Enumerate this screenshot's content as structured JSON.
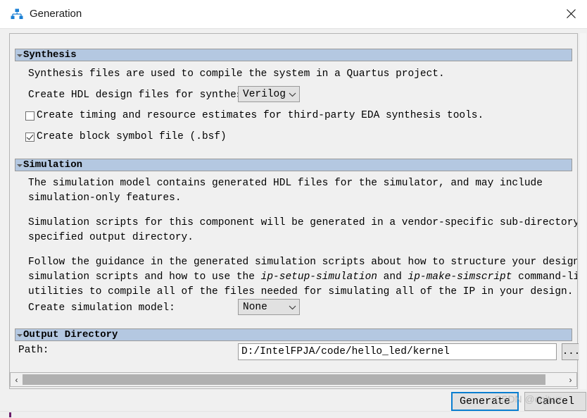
{
  "window": {
    "title": "Generation",
    "icon": "hierarchy-icon",
    "close_icon": "close-icon"
  },
  "sections": {
    "synthesis": {
      "title": "Synthesis",
      "collapse_icon": "chevron-down-icon",
      "paragraph": "Synthesis files are used to compile the system in a Quartus project.",
      "hdl_label": "Create HDL design files for synthesis:",
      "hdl_value": "Verilog",
      "checkboxes": [
        {
          "label": "Create timing and resource estimates for third-party EDA synthesis tools.",
          "checked": false
        },
        {
          "label": "Create block symbol file (.bsf)",
          "checked": true
        }
      ]
    },
    "simulation": {
      "title": "Simulation",
      "collapse_icon": "chevron-down-icon",
      "para1_line1": "The simulation model contains generated HDL files for the simulator, and may include",
      "para1_line2": "simulation-only features.",
      "para2_line1": "Simulation scripts for this component will be generated in a vendor-specific sub-directory in the",
      "para2_line2": "specified output directory.",
      "para3_line1": "Follow the guidance in the generated simulation scripts about how to structure your design's",
      "para3_line2_a": "simulation scripts and how to use the ",
      "para3_line2_italic1": "ip-setup-simulation",
      "para3_line2_b": " and ",
      "para3_line2_italic2": "ip-make-simscript",
      "para3_line2_c": " command-line",
      "para3_line3": "utilities to compile all of the files needed for simulating all of the IP in your design.",
      "model_label": "Create simulation model:",
      "model_value": "None"
    },
    "output_directory": {
      "title": "Output Directory",
      "collapse_icon": "chevron-down-icon",
      "path_label": "Path:",
      "path_value": "D:/IntelFPJA/code/hello_led/kernel",
      "path_placeholder": "",
      "browse_label": "..."
    }
  },
  "scrollbar": {
    "left_arrow": "‹",
    "right_arrow": "›"
  },
  "footer": {
    "generate_label": "Generate",
    "cancel_label": "Cancel"
  },
  "watermark": {
    "text": "CSDN @cqjtwz"
  },
  "colors": {
    "section_header": "#b4c8e1",
    "panel": "#f0f0f0",
    "accent_focus": "#0a7ed0",
    "icon_blue": "#1a7fd4"
  }
}
